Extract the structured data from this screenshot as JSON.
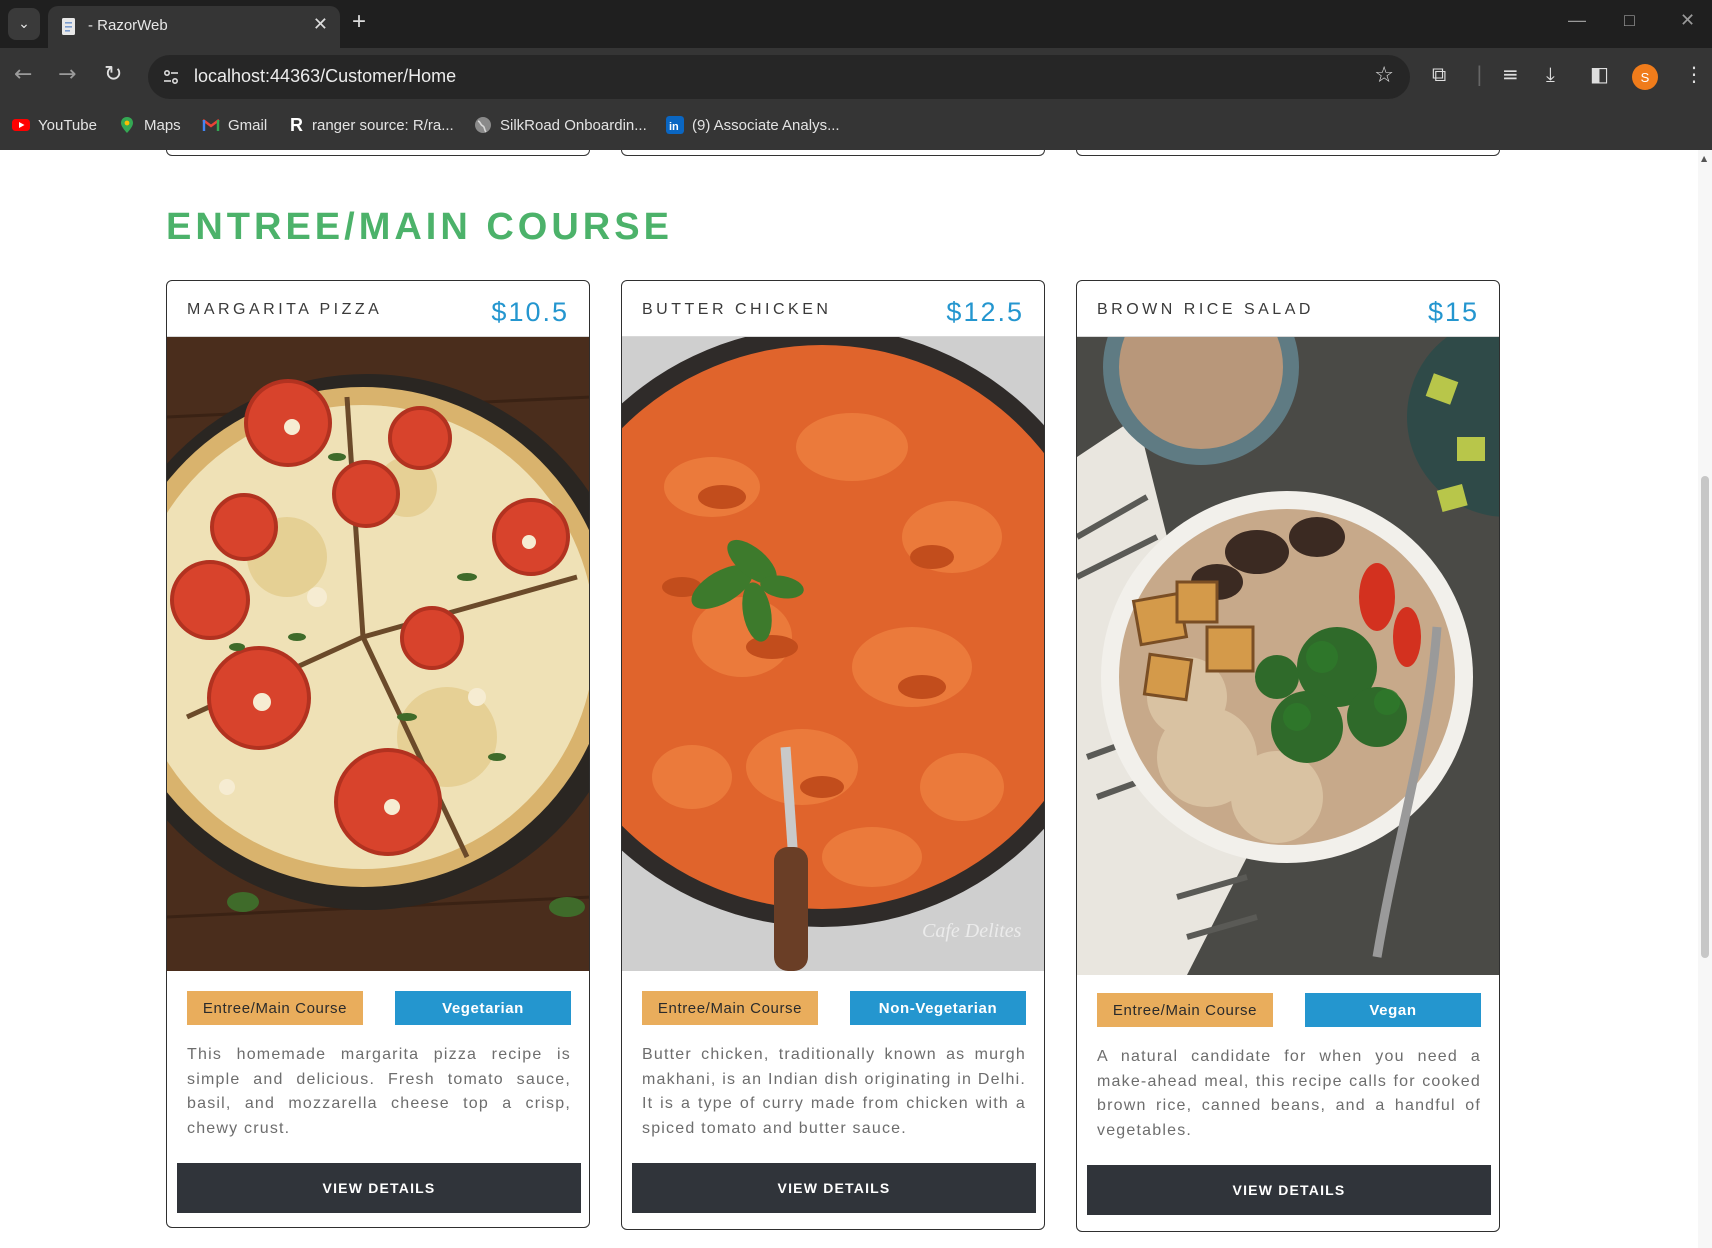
{
  "browser": {
    "tab_title": "- RazorWeb",
    "url": "localhost:44363/Customer/Home",
    "profile_initial": "S",
    "bookmarks": [
      {
        "label": "YouTube",
        "icon": "youtube-icon"
      },
      {
        "label": "Maps",
        "icon": "maps-icon"
      },
      {
        "label": "Gmail",
        "icon": "gmail-icon"
      },
      {
        "label": "ranger source: R/ra...",
        "icon": "r-icon"
      },
      {
        "label": "SilkRoad Onboardin...",
        "icon": "globe-icon"
      },
      {
        "label": "(9) Associate Analys...",
        "icon": "linkedin-icon"
      }
    ]
  },
  "page": {
    "section_title": "ENTREE/MAIN COURSE",
    "accent_color": "#4cb26a",
    "price_color": "#2496cf",
    "cards": [
      {
        "name": "MARGARITA PIZZA",
        "price": "$10.5",
        "image": "margarita-pizza-photo",
        "category": "Entree/Main Course",
        "diet": "Vegetarian",
        "description": "This homemade margarita pizza recipe is simple and delicious. Fresh tomato sauce, basil, and mozzarella cheese top a crisp, chewy crust.",
        "button": "VIEW DETAILS"
      },
      {
        "name": "BUTTER CHICKEN",
        "price": "$12.5",
        "image": "butter-chicken-photo",
        "category": "Entree/Main Course",
        "diet": "Non-Vegetarian",
        "description": "Butter chicken, traditionally known as murgh makhani, is an Indian dish originating in Delhi. It is a type of curry made from chicken with a spiced tomato and butter sauce.",
        "button": "VIEW DETAILS"
      },
      {
        "name": "BROWN RICE SALAD",
        "price": "$15",
        "image": "brown-rice-salad-photo",
        "category": "Entree/Main Course",
        "diet": "Vegan",
        "description": "A natural candidate for when you need a make-ahead meal, this recipe calls for cooked brown rice, canned beans, and a handful of vegetables.",
        "button": "VIEW DETAILS"
      }
    ]
  }
}
